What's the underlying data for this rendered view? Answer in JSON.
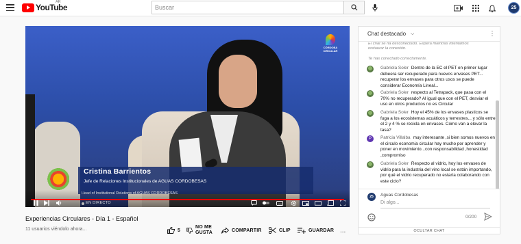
{
  "header": {
    "logo_text": "YouTube",
    "country_code": "AR",
    "search_placeholder": "Buscar",
    "avatar_initials": "25"
  },
  "video": {
    "lower_third": {
      "name": "Cristina Barrientos",
      "role_es": "Jefe de Relaciones Institucionales de AGUAS CORDOBESAS",
      "role_en": "Head of Institutional Relations of AGUAS CORDOBESAS"
    },
    "event_logo_text": "CÓRDOBA\nCIRCULAR",
    "live_label": "EN DIRECTO",
    "progress_fraction": 1.0
  },
  "info": {
    "title": "Experiencias Circulares - Día 1 - Español",
    "views": "11 usuarios viéndolo ahora...",
    "actions": {
      "like_count": "5",
      "dislike_label": "NO ME\nGUSTA",
      "share_label": "COMPARTIR",
      "clip_label": "CLIP",
      "save_label": "GUARDAR"
    },
    "more": "..."
  },
  "chat": {
    "title": "Chat destacado",
    "system_messages": [
      "El chat se ha desconectado. Espera mientras intentamos restaurar la conexión.",
      "Te has conectado correctamente."
    ],
    "messages": [
      {
        "author": "Gabriela Soler",
        "text": "Dentro de la EC el PET en primer lugar debeera ser recuperado para nuevos envases PET... recuperar los envases para otros usos se puede considerar Economía Lineal...",
        "avatar": "photo"
      },
      {
        "author": "Gabriela Soler",
        "text": "respecto al Tetrapack, que pasa con el 70% no recuperado? Al igual que con el PET, desviar el uso en otros productos no es Circular",
        "avatar": "photo"
      },
      {
        "author": "Gabriela Soler",
        "text": "Hoy el 45% de los envases plasticos se fuga a los ecosistemas acuáticos y terrestres... y sólo entre el 2 y 4 % se recicla en envases. Cómo van a elevar la tasa?",
        "avatar": "photo"
      },
      {
        "author": "Patricia Villalba",
        "text": "muy interesante ,si bien somos nuevos en el circulo economia circular hay mucho por aprender y poner en movimiento...con responsabilidad ,honestidad ,compromiso",
        "avatar": "P"
      },
      {
        "author": "Gabriela Soler",
        "text": "Respecto al vidrio, hoy los envases de vidrio para la industria del vino local se están importando, por qué el vidrio recuperado no estaría colaborando con este ciclo?",
        "avatar": "photo"
      }
    ],
    "input": {
      "user": "Aguas Cordobesas",
      "placeholder": "Di algo...",
      "char_count": "0/200",
      "avatar_initials": "25"
    },
    "hide_label": "OCULTAR CHAT"
  },
  "colors": {
    "brand_red": "#ff0000",
    "chat_avatar_purple": "#5e35b1",
    "lower_third_blue": "#162d6e"
  }
}
